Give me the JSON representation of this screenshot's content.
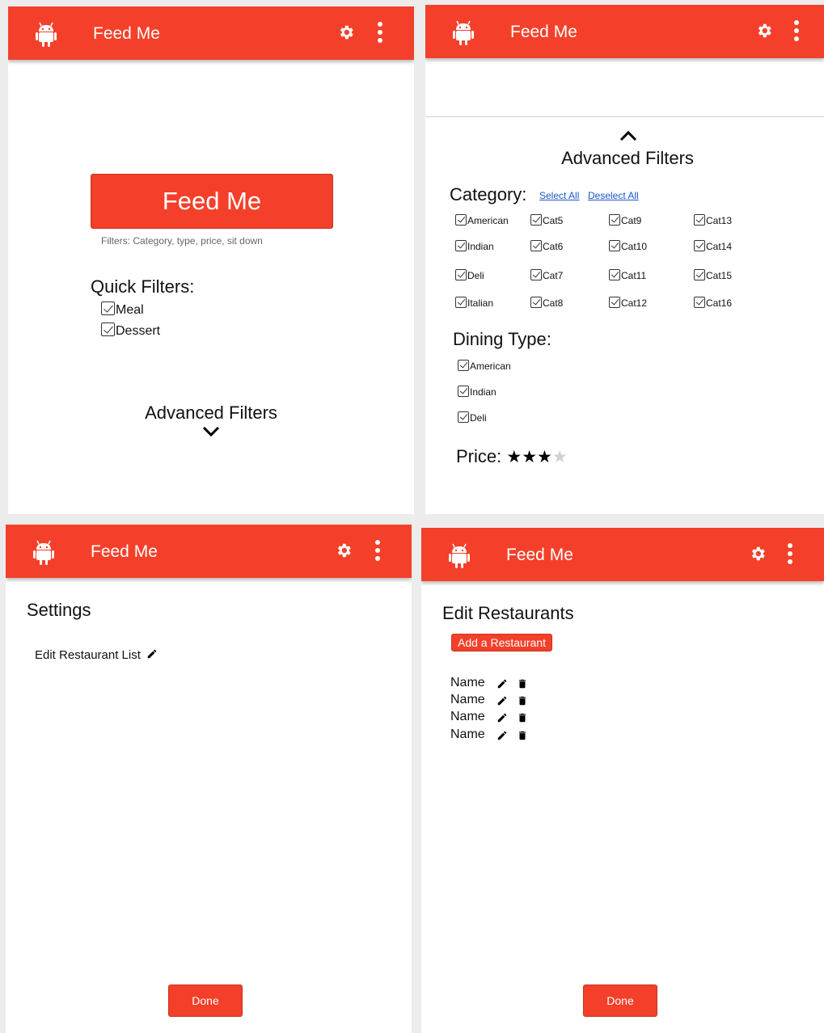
{
  "app": {
    "title": "Feed Me",
    "icons": [
      "android-logo-icon",
      "gear-icon",
      "more-vert-icon"
    ]
  },
  "colors": {
    "accent": "#f4402a",
    "link": "#1a56c9"
  },
  "home": {
    "feed_button": "Feed Me",
    "filters_hint": "Filters: Category, type, price, sit down",
    "quick_filters_title": "Quick Filters:",
    "quick_filters": [
      {
        "label": "Meal",
        "checked": true
      },
      {
        "label": "Dessert",
        "checked": true
      }
    ],
    "advanced_filters_label": "Advanced Filters"
  },
  "advanced": {
    "title": "Advanced Filters",
    "category_title": "Category:",
    "select_all": "Select All",
    "deselect_all": "Deselect All",
    "categories": [
      [
        "American",
        "Indian",
        "Deli",
        "Italian"
      ],
      [
        "Cat5",
        "Cat6",
        "Cat7",
        "Cat8"
      ],
      [
        "Cat9",
        "Cat10",
        "Cat11",
        "Cat12"
      ],
      [
        "Cat13",
        "Cat14",
        "Cat15",
        "Cat16"
      ]
    ],
    "dining_title": "Dining Type:",
    "dining_types": [
      "American",
      "Indian",
      "Deli"
    ],
    "price_label": "Price:",
    "price_rating": 3,
    "price_max": 4,
    "star_char": "★"
  },
  "settings": {
    "title": "Settings",
    "edit_list": "Edit Restaurant List",
    "done": "Done"
  },
  "edit": {
    "title": "Edit Restaurants",
    "add_button": "Add a Restaurant",
    "rows": [
      "Name",
      "Name",
      "Name",
      "Name"
    ],
    "done": "Done"
  }
}
